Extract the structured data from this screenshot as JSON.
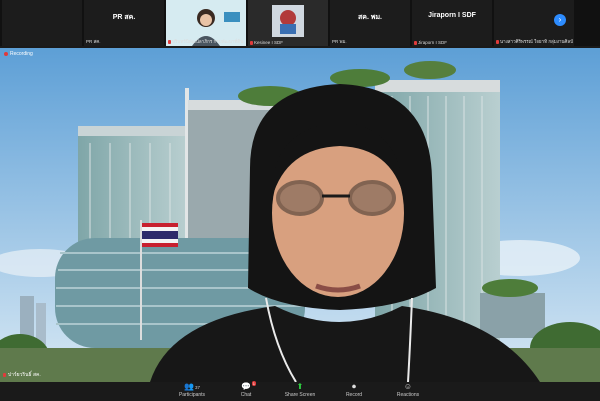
{
  "thumbnails": [
    {
      "type": "name",
      "big": "",
      "small": ""
    },
    {
      "type": "name",
      "big": "PR สค.",
      "small": "PR สค."
    },
    {
      "type": "video",
      "big": "",
      "small": "ปรินทร์นิพัฒน์ลาภิกร กรมพัฒนาที่ดิน"
    },
    {
      "type": "video",
      "big": "",
      "small": "Kesinee I SDF"
    },
    {
      "type": "name",
      "big": "สค. พม.",
      "small": "PR พม."
    },
    {
      "type": "name",
      "big": "Jiraporn I SDF",
      "small": "Jiraporn I SDF"
    },
    {
      "type": "name",
      "big": "",
      "small": "นางสาวศิริพรรณ์ ใจยาทิ กลุ่มงานศิลป์"
    }
  ],
  "stage": {
    "recording_label": "Recording",
    "speaker_label": "ปาร์ยวรินธิ์ สค."
  },
  "toolbar": [
    {
      "name": "participants",
      "icon": "people-icon",
      "label": "Participants",
      "count": "37"
    },
    {
      "name": "chat",
      "icon": "chat-icon",
      "label": "Chat",
      "badge": "1"
    },
    {
      "name": "share",
      "icon": "share-screen-icon",
      "label": "Share Screen"
    },
    {
      "name": "record",
      "icon": "record-icon",
      "label": "Record"
    },
    {
      "name": "reactions",
      "icon": "reactions-icon",
      "label": "Reactions"
    }
  ],
  "colors": {
    "accent": "#2d8cff",
    "share": "#2ecc40",
    "alert": "#e03b3b"
  }
}
